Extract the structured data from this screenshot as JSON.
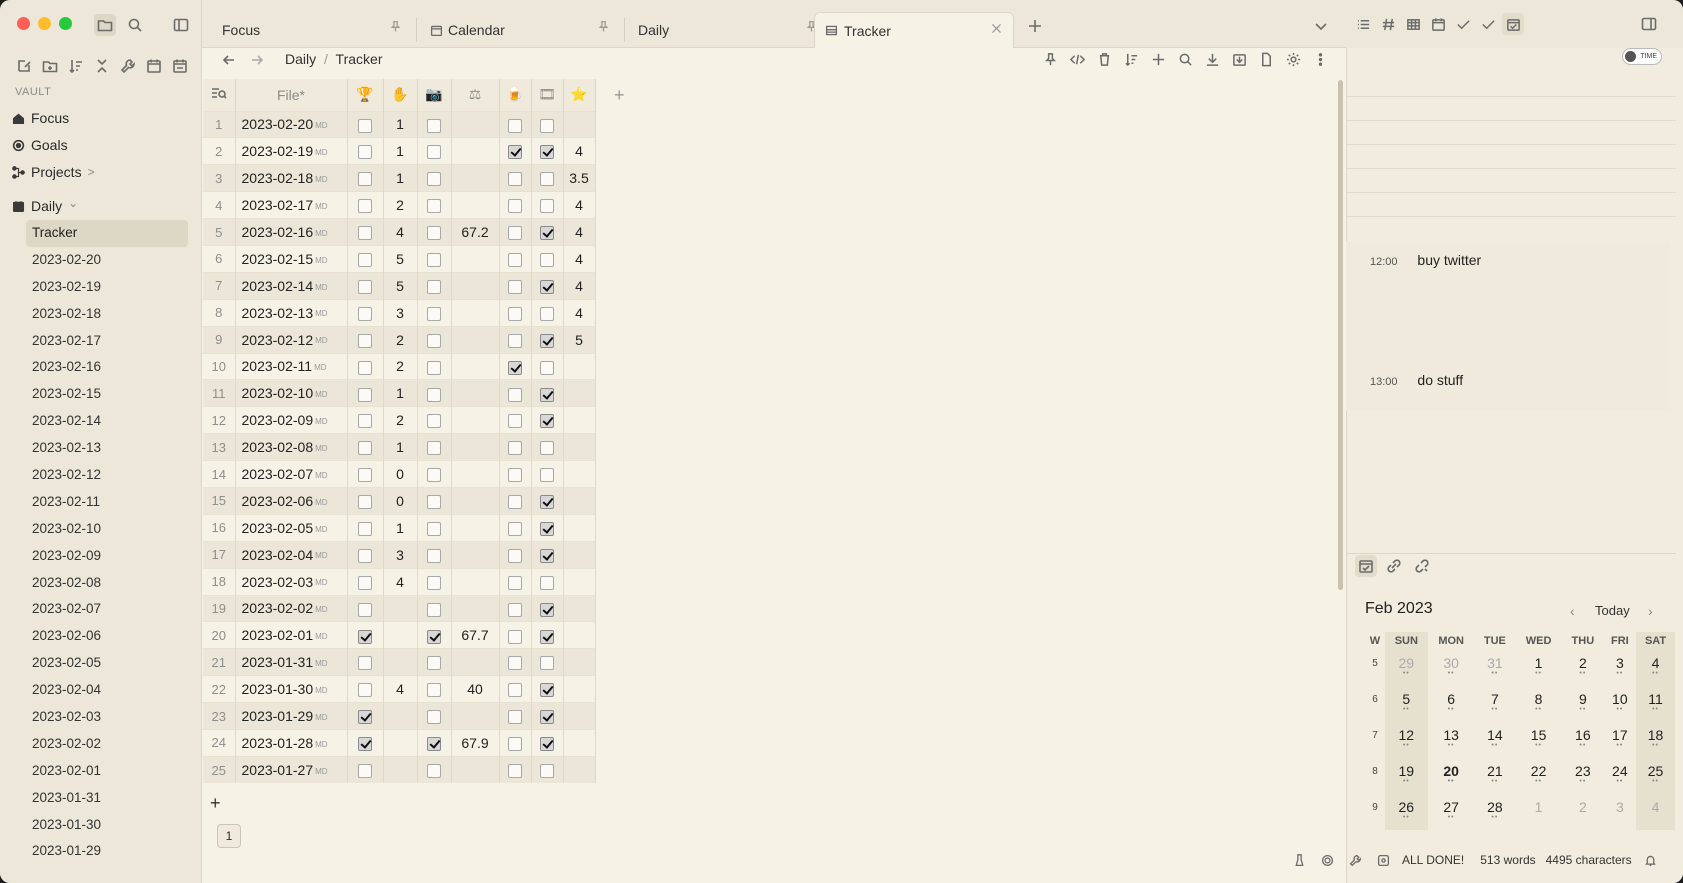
{
  "sidebar": {
    "vault_label": "VAULT",
    "nav": [
      {
        "label": "Focus",
        "icon": "home-icon"
      },
      {
        "label": "Goals",
        "icon": "target-icon"
      },
      {
        "label": "Projects",
        "icon": "tree-icon",
        "chevron": ">"
      }
    ],
    "folder": {
      "label": "Daily",
      "chevron": "⌄"
    },
    "items": [
      "Tracker",
      "2023-02-20",
      "2023-02-19",
      "2023-02-18",
      "2023-02-17",
      "2023-02-16",
      "2023-02-15",
      "2023-02-14",
      "2023-02-13",
      "2023-02-12",
      "2023-02-11",
      "2023-02-10",
      "2023-02-09",
      "2023-02-08",
      "2023-02-07",
      "2023-02-06",
      "2023-02-05",
      "2023-02-04",
      "2023-02-03",
      "2023-02-02",
      "2023-02-01",
      "2023-01-31",
      "2023-01-30",
      "2023-01-29"
    ],
    "selected": "Tracker"
  },
  "tabs": [
    {
      "label": "Focus",
      "active": false
    },
    {
      "label": "Calendar",
      "active": false
    },
    {
      "label": "Daily",
      "active": false
    },
    {
      "label": "Tracker",
      "active": true
    }
  ],
  "breadcrumb": {
    "parent": "Daily",
    "sep": "/",
    "current": "Tracker"
  },
  "table": {
    "file_header": "File*",
    "add_col": "+",
    "add_row": "+",
    "page": "1",
    "md_badge": "MD",
    "rows": [
      {
        "n": "1",
        "file": "2023-02-20",
        "c1": false,
        "c2": "1",
        "c3": false,
        "c4": "",
        "c5": false,
        "c6": false,
        "c7": ""
      },
      {
        "n": "2",
        "file": "2023-02-19",
        "c1": false,
        "c2": "1",
        "c3": false,
        "c4": "",
        "c5": true,
        "c6": true,
        "c7": "4"
      },
      {
        "n": "3",
        "file": "2023-02-18",
        "c1": false,
        "c2": "1",
        "c3": false,
        "c4": "",
        "c5": false,
        "c6": false,
        "c7": "3.5"
      },
      {
        "n": "4",
        "file": "2023-02-17",
        "c1": false,
        "c2": "2",
        "c3": false,
        "c4": "",
        "c5": false,
        "c6": false,
        "c7": "4"
      },
      {
        "n": "5",
        "file": "2023-02-16",
        "c1": false,
        "c2": "4",
        "c3": false,
        "c4": "67.2",
        "c5": false,
        "c6": true,
        "c7": "4"
      },
      {
        "n": "6",
        "file": "2023-02-15",
        "c1": false,
        "c2": "5",
        "c3": false,
        "c4": "",
        "c5": false,
        "c6": false,
        "c7": "4"
      },
      {
        "n": "7",
        "file": "2023-02-14",
        "c1": false,
        "c2": "5",
        "c3": false,
        "c4": "",
        "c5": false,
        "c6": true,
        "c7": "4"
      },
      {
        "n": "8",
        "file": "2023-02-13",
        "c1": false,
        "c2": "3",
        "c3": false,
        "c4": "",
        "c5": false,
        "c6": false,
        "c7": "4"
      },
      {
        "n": "9",
        "file": "2023-02-12",
        "c1": false,
        "c2": "2",
        "c3": false,
        "c4": "",
        "c5": false,
        "c6": true,
        "c7": "5"
      },
      {
        "n": "10",
        "file": "2023-02-11",
        "c1": false,
        "c2": "2",
        "c3": false,
        "c4": "",
        "c5": true,
        "c6": false,
        "c7": ""
      },
      {
        "n": "11",
        "file": "2023-02-10",
        "c1": false,
        "c2": "1",
        "c3": false,
        "c4": "",
        "c5": false,
        "c6": true,
        "c7": ""
      },
      {
        "n": "12",
        "file": "2023-02-09",
        "c1": false,
        "c2": "2",
        "c3": false,
        "c4": "",
        "c5": false,
        "c6": true,
        "c7": ""
      },
      {
        "n": "13",
        "file": "2023-02-08",
        "c1": false,
        "c2": "1",
        "c3": false,
        "c4": "",
        "c5": false,
        "c6": false,
        "c7": ""
      },
      {
        "n": "14",
        "file": "2023-02-07",
        "c1": false,
        "c2": "0",
        "c3": false,
        "c4": "",
        "c5": false,
        "c6": false,
        "c7": ""
      },
      {
        "n": "15",
        "file": "2023-02-06",
        "c1": false,
        "c2": "0",
        "c3": false,
        "c4": "",
        "c5": false,
        "c6": true,
        "c7": ""
      },
      {
        "n": "16",
        "file": "2023-02-05",
        "c1": false,
        "c2": "1",
        "c3": false,
        "c4": "",
        "c5": false,
        "c6": true,
        "c7": ""
      },
      {
        "n": "17",
        "file": "2023-02-04",
        "c1": false,
        "c2": "3",
        "c3": false,
        "c4": "",
        "c5": false,
        "c6": true,
        "c7": ""
      },
      {
        "n": "18",
        "file": "2023-02-03",
        "c1": false,
        "c2": "4",
        "c3": false,
        "c4": "",
        "c5": false,
        "c6": false,
        "c7": ""
      },
      {
        "n": "19",
        "file": "2023-02-02",
        "c1": false,
        "c2": "",
        "c3": false,
        "c4": "",
        "c5": false,
        "c6": true,
        "c7": ""
      },
      {
        "n": "20",
        "file": "2023-02-01",
        "c1": true,
        "c2": "",
        "c3": true,
        "c4": "67.7",
        "c5": false,
        "c6": true,
        "c7": ""
      },
      {
        "n": "21",
        "file": "2023-01-31",
        "c1": false,
        "c2": "",
        "c3": false,
        "c4": "",
        "c5": false,
        "c6": false,
        "c7": ""
      },
      {
        "n": "22",
        "file": "2023-01-30",
        "c1": false,
        "c2": "4",
        "c3": false,
        "c4": "40",
        "c5": false,
        "c6": true,
        "c7": ""
      },
      {
        "n": "23",
        "file": "2023-01-29",
        "c1": true,
        "c2": "",
        "c3": false,
        "c4": "",
        "c5": false,
        "c6": true,
        "c7": ""
      },
      {
        "n": "24",
        "file": "2023-01-28",
        "c1": true,
        "c2": "",
        "c3": true,
        "c4": "67.9",
        "c5": false,
        "c6": true,
        "c7": ""
      },
      {
        "n": "25",
        "file": "2023-01-27",
        "c1": false,
        "c2": "",
        "c3": false,
        "c4": "",
        "c5": false,
        "c6": false,
        "c7": ""
      }
    ]
  },
  "right": {
    "toggle_label": "TIME",
    "events": [
      {
        "time": "12:00",
        "title": "buy twitter"
      },
      {
        "time": "13:00",
        "title": "do stuff"
      }
    ],
    "calendar": {
      "month": "Feb 2023",
      "today_label": "Today",
      "prev": "‹",
      "next": "›",
      "headers": [
        "W",
        "SUN",
        "MON",
        "TUE",
        "WED",
        "THU",
        "FRI",
        "SAT"
      ],
      "weeks": [
        {
          "w": "5",
          "days": [
            "29",
            "30",
            "31",
            "1",
            "2",
            "3",
            "4"
          ],
          "dim": [
            true,
            true,
            true,
            false,
            false,
            false,
            false
          ]
        },
        {
          "w": "6",
          "days": [
            "5",
            "6",
            "7",
            "8",
            "9",
            "10",
            "11"
          ],
          "dim": [
            false,
            false,
            false,
            false,
            false,
            false,
            false
          ]
        },
        {
          "w": "7",
          "days": [
            "12",
            "13",
            "14",
            "15",
            "16",
            "17",
            "18"
          ],
          "dim": [
            false,
            false,
            false,
            false,
            false,
            false,
            false
          ]
        },
        {
          "w": "8",
          "days": [
            "19",
            "20",
            "21",
            "22",
            "23",
            "24",
            "25"
          ],
          "dim": [
            false,
            false,
            false,
            false,
            false,
            false,
            false
          ]
        },
        {
          "w": "9",
          "days": [
            "26",
            "27",
            "28",
            "1",
            "2",
            "3",
            "4"
          ],
          "dim": [
            false,
            false,
            false,
            true,
            true,
            true,
            true
          ]
        }
      ],
      "today": "20"
    }
  },
  "status": {
    "done": "ALL DONE!",
    "words": "513 words",
    "chars": "4495 characters"
  }
}
